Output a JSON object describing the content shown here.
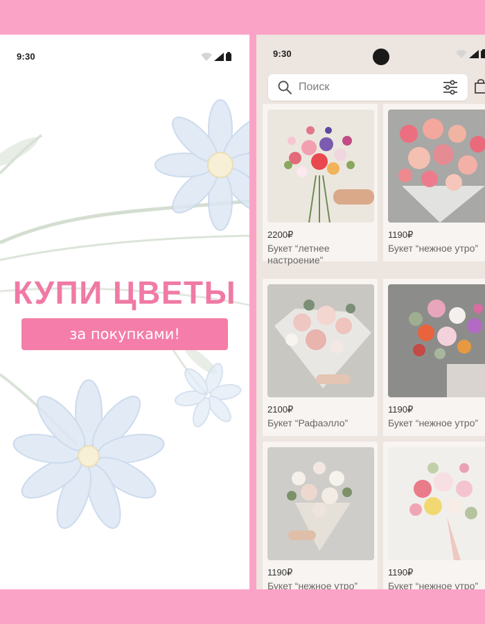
{
  "colors": {
    "frame": "#fba3c6",
    "accent_pink": "#f07aa5",
    "button_pink": "#f47ea9",
    "catalog_bg": "#ede5e0",
    "card_bg": "#f8f4f1"
  },
  "promo_screen": {
    "status_time": "9:30",
    "title": "КУПИ ЦВЕТЫ",
    "button_label": "за покупками!"
  },
  "catalog_screen": {
    "status_time": "9:30",
    "search": {
      "placeholder": "Поиск",
      "icon": "search-icon"
    },
    "filter_icon": "sliders-icon",
    "cart_icon": "shopping-bag-icon",
    "products": [
      {
        "price": "2200₽",
        "name": "Букет “летнее настроение”"
      },
      {
        "price": "1190₽",
        "name": "Букет “нежное утро”"
      },
      {
        "price": "2100₽",
        "name": "Букет “Рафаэлло”"
      },
      {
        "price": "1190₽",
        "name": "Букет “нежное утро”"
      },
      {
        "price": "1190₽",
        "name": "Букет “нежное утро”"
      },
      {
        "price": "1190₽",
        "name": "Букет “нежное утро”"
      }
    ]
  }
}
